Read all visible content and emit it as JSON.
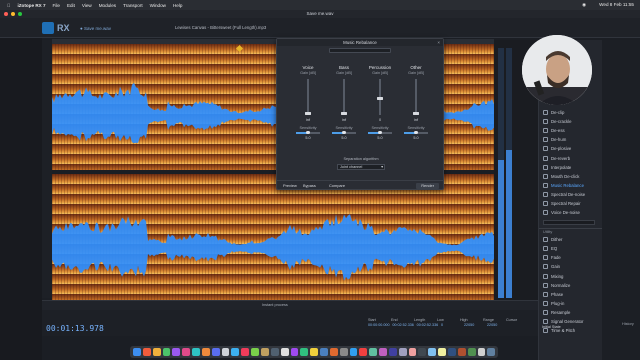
{
  "menubar": {
    "app": "iZotope RX 7",
    "items": [
      "File",
      "Edit",
      "View",
      "Modules",
      "Transport",
      "Window",
      "Help"
    ],
    "clock": "Wed 8 Feb 11:55"
  },
  "window": {
    "title": "Save me.wav"
  },
  "header": {
    "logo": "RX",
    "save_label": "Save me.wav",
    "file_tab": "Lewises Canvas - Bittersweet (Full Length).mp3"
  },
  "dialog": {
    "title": "Music Rebalance",
    "columns": [
      {
        "name": "Voice",
        "gain_label": "Gain [dB]",
        "gain_value": "inf",
        "gain_level": 1.0,
        "sens_label": "Sensitivity",
        "sens_value": "5.0",
        "sens_level": 0.5
      },
      {
        "name": "Bass",
        "gain_label": "Gain [dB]",
        "gain_value": "inf",
        "gain_level": 1.0,
        "sens_label": "Sensitivity",
        "sens_value": "5.0",
        "sens_level": 0.5
      },
      {
        "name": "Percussion",
        "gain_label": "Gain [dB]",
        "gain_value": "0",
        "gain_level": 0.55,
        "sens_label": "Sensitivity",
        "sens_value": "5.0",
        "sens_level": 0.5
      },
      {
        "name": "Other",
        "gain_label": "Gain [dB]",
        "gain_value": "inf",
        "gain_level": 1.0,
        "sens_label": "Sensitivity",
        "sens_value": "5.0",
        "sens_level": 0.5
      }
    ],
    "separation_label": "Separation algorithm",
    "separation_value": "Joint channel",
    "preview_label": "Preview",
    "bypass_label": "Bypass",
    "compare_label": "Compare",
    "process_label": "Render"
  },
  "modules": {
    "items": [
      {
        "label": "De-clip",
        "active": false
      },
      {
        "label": "De-crackle",
        "active": false
      },
      {
        "label": "De-ess",
        "active": false
      },
      {
        "label": "De-hum",
        "active": false
      },
      {
        "label": "De-plosive",
        "active": false
      },
      {
        "label": "De-reverb",
        "active": false
      },
      {
        "label": "Interpolate",
        "active": false
      },
      {
        "label": "Mouth De-click",
        "active": false
      },
      {
        "label": "Music Rebalance",
        "active": true
      },
      {
        "label": "Spectral De-noise",
        "active": false
      },
      {
        "label": "Spectral Repair",
        "active": false
      },
      {
        "label": "Voice De-noise",
        "active": false
      }
    ],
    "utility_label": "Utility",
    "utility_items": [
      {
        "label": "Dither"
      },
      {
        "label": "EQ"
      },
      {
        "label": "Fade"
      },
      {
        "label": "Gain"
      },
      {
        "label": "Mixing"
      },
      {
        "label": "Normalize"
      },
      {
        "label": "Phase"
      },
      {
        "label": "Plug-in"
      },
      {
        "label": "Resample"
      },
      {
        "label": "Signal Generator"
      },
      {
        "label": "Time & Pitch"
      }
    ]
  },
  "transport": {
    "timecode": "00:01:13.978",
    "label": "Instant process"
  },
  "info": {
    "headers": [
      "Start",
      "End",
      "Length",
      "Low",
      "High",
      "Range",
      "Cursor"
    ],
    "row1": [
      "00:01:13.978",
      "",
      "",
      "",
      "",
      "",
      ""
    ],
    "row2": [
      "00:00:00.000",
      "00:02:52.336",
      "00:02:52.336",
      "0",
      "22050",
      "22050",
      ""
    ]
  },
  "history": {
    "title": "History",
    "item": "Initial State"
  },
  "colors": {
    "accent": "#4d9de8",
    "waveform": "#2f8fff",
    "spectro_hot": "#e39a3a",
    "spectro_dark": "#7a3418",
    "marker": "#e8b528"
  }
}
